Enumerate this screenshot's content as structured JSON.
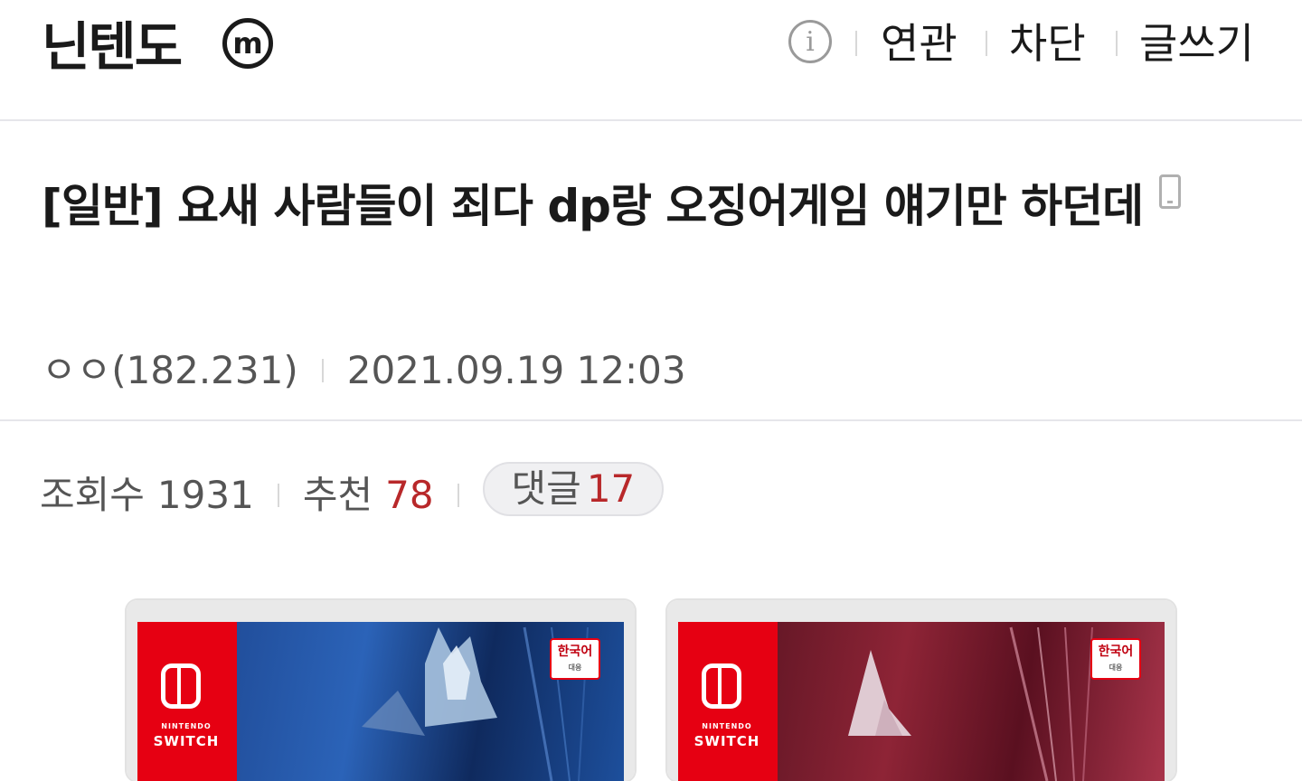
{
  "header": {
    "gallery_title": "닌텐도",
    "minor_badge": "m",
    "info_icon_glyph": "i",
    "links": [
      "연관",
      "차단",
      "글쓰기"
    ]
  },
  "post": {
    "title": "[일반] 요새 사람들이 죄다 dp랑 오징어게임 얘기만 하던데",
    "author": "ㅇㅇ(182.231)",
    "date": "2021.09.19 12:03",
    "views_label": "조회수",
    "views": "1931",
    "recommend_label": "추천",
    "recommend": "78",
    "comments_label": "댓글",
    "comments": "17"
  },
  "covers": [
    {
      "switch_small": "NINTENDO",
      "switch_label": "SWITCH",
      "lang_badge": "한국어",
      "lang_sub": "대응",
      "theme": "#1f4d9a"
    },
    {
      "switch_small": "NINTENDO",
      "switch_label": "SWITCH",
      "lang_badge": "한국어",
      "lang_sub": "대응",
      "theme": "#8a1c2c"
    }
  ],
  "colors": {
    "accent_red": "#b8282a",
    "nintendo_red": "#e60012"
  }
}
